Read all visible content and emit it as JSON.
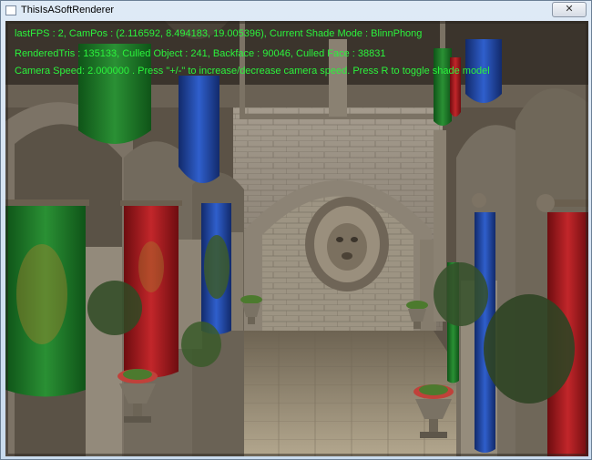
{
  "window": {
    "title": "ThisIsASoftRenderer",
    "close_glyph": "✕"
  },
  "hud": {
    "line1": "lastFPS : 2, CamPos : (2.116592, 8.494183, 19.005396), Current Shade Mode : BlinnPhong",
    "line2": "RenderedTris : 135133, Culled Object : 241, Backface : 90046, Culled Face : 38831",
    "line3": "Camera Speed: 2.000000 . Press \"+/-\" to increase/decrease camera speed. Press R to toggle shade model",
    "color": "#2bf33c"
  },
  "scene": {
    "description_icon": "sponza-atrium-3d-render",
    "colors": {
      "stone": "#8a8174",
      "stone_dark": "#4e463b",
      "floor": "#a69a83",
      "curtain_green": "#1f7a2a",
      "curtain_red": "#a3181c",
      "curtain_blue": "#1d3f9a",
      "foliage": "#3f6a2e"
    }
  }
}
